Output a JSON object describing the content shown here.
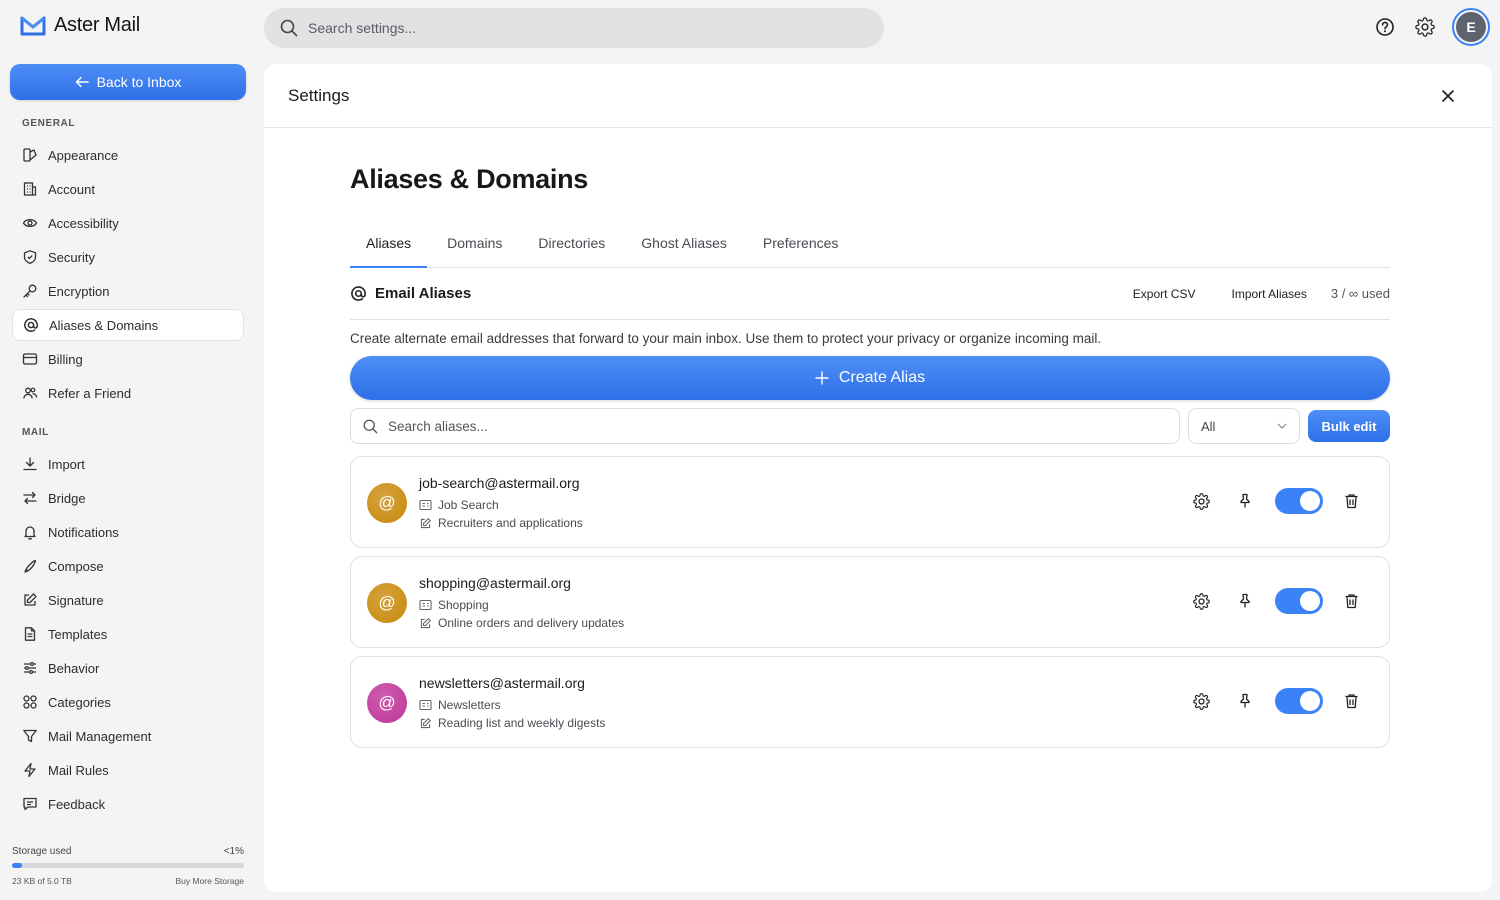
{
  "app": {
    "name": "Aster Mail",
    "logo_icon": "envelope-logo-icon"
  },
  "topbar": {
    "search_placeholder": "Search settings...",
    "help_icon": "help-icon",
    "gear_icon": "gear-icon",
    "avatar_initial": "E"
  },
  "sidebar": {
    "back_label": "Back to Inbox",
    "general_label": "GENERAL",
    "mail_label": "MAIL",
    "general_items": [
      {
        "label": "Appearance",
        "icon": "appearance-icon"
      },
      {
        "label": "Account",
        "icon": "building-icon"
      },
      {
        "label": "Accessibility",
        "icon": "eye-icon"
      },
      {
        "label": "Security",
        "icon": "shield-icon"
      },
      {
        "label": "Encryption",
        "icon": "key-icon"
      },
      {
        "label": "Aliases & Domains",
        "icon": "at-icon",
        "active": true
      },
      {
        "label": "Billing",
        "icon": "card-icon"
      },
      {
        "label": "Refer a Friend",
        "icon": "users-icon"
      }
    ],
    "mail_items": [
      {
        "label": "Import",
        "icon": "download-icon"
      },
      {
        "label": "Bridge",
        "icon": "arrows-icon"
      },
      {
        "label": "Notifications",
        "icon": "bell-icon"
      },
      {
        "label": "Compose",
        "icon": "pen-icon"
      },
      {
        "label": "Signature",
        "icon": "edit-icon"
      },
      {
        "label": "Templates",
        "icon": "file-icon"
      },
      {
        "label": "Behavior",
        "icon": "sliders-icon"
      },
      {
        "label": "Categories",
        "icon": "grid-icon"
      },
      {
        "label": "Mail Management",
        "icon": "filter-icon"
      },
      {
        "label": "Mail Rules",
        "icon": "bolt-icon"
      },
      {
        "label": "Feedback",
        "icon": "message-icon"
      }
    ],
    "storage": {
      "label": "Storage used",
      "percent_label": "<1%",
      "used_label": "23 KB of 5.0 TB",
      "buy_label": "Buy More Storage",
      "used_fraction": 1e-05
    }
  },
  "panel": {
    "title": "Settings",
    "page_title": "Aliases & Domains",
    "tabs": [
      {
        "label": "Aliases",
        "active": true
      },
      {
        "label": "Domains"
      },
      {
        "label": "Directories"
      },
      {
        "label": "Ghost Aliases"
      },
      {
        "label": "Preferences"
      }
    ],
    "section": {
      "title": "Email Aliases",
      "export_label": "Export CSV",
      "import_label": "Import Aliases",
      "usage_label": "3 / ∞ used",
      "description": "Create alternate email addresses that forward to your main inbox. Use them to protect your privacy or organize incoming mail.",
      "create_label": "Create Alias",
      "search_placeholder": "Search aliases...",
      "filter_value": "All",
      "bulk_label": "Bulk edit"
    },
    "aliases": [
      {
        "email": "job-search@astermail.org",
        "label": "Job Search",
        "note": "Recruiters and applications",
        "color": "#c98a0c",
        "enabled": true
      },
      {
        "email": "shopping@astermail.org",
        "label": "Shopping",
        "note": "Online orders and delivery updates",
        "color": "#c98a0c",
        "enabled": true
      },
      {
        "email": "newsletters@astermail.org",
        "label": "Newsletters",
        "note": "Reading list and weekly digests",
        "color": "#c0359a",
        "enabled": true
      }
    ],
    "colors": {
      "accent": "#3b82f6"
    }
  }
}
